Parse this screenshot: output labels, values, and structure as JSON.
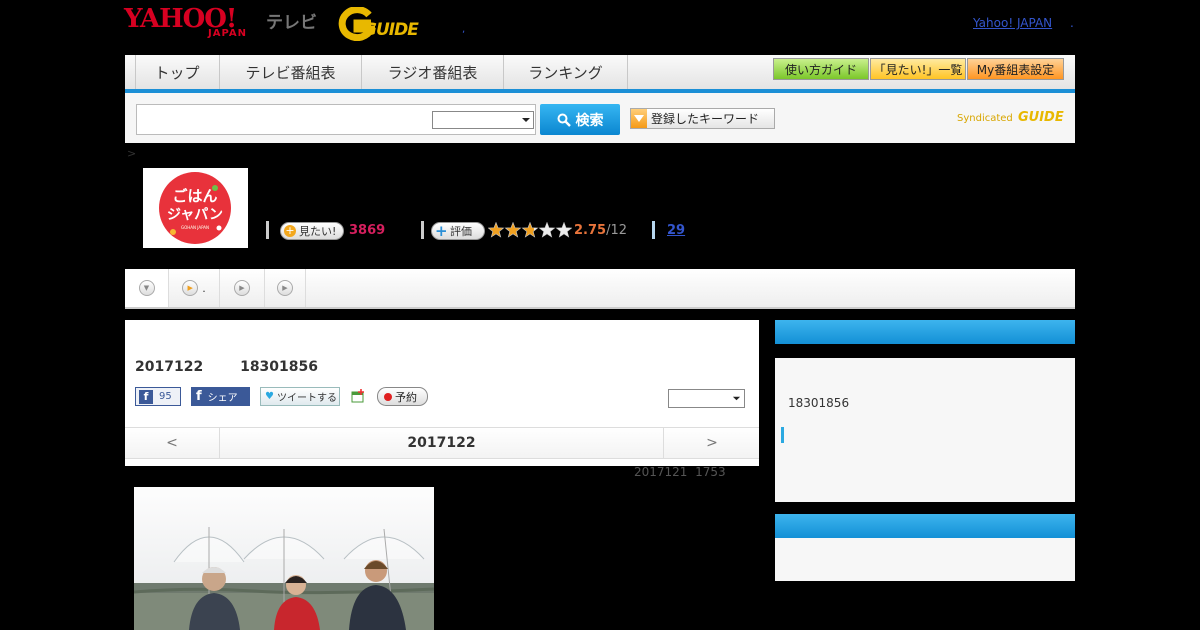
{
  "header": {
    "logo_text": "YAHOO!",
    "logo_sub": "JAPAN",
    "tv_label": "テレビ",
    "gguide_logo": "GUIDE",
    "yahoo_japan_link": "Yahoo! JAPAN",
    "link_dot": ".",
    "dot2": ","
  },
  "nav": {
    "tabs": [
      "トップ",
      "テレビ番組表",
      "ラジオ番組表",
      "ランキング"
    ],
    "buttons": [
      "使い方ガイド",
      "「見たい!」一覧",
      "My番組表設定"
    ],
    "button_colors": [
      "#8fd13f",
      "#ffd54a",
      "#ffa33b"
    ]
  },
  "search": {
    "placeholder": "",
    "button_label": "検索",
    "keyword_button_label": "登録したキーワード",
    "syndicated_label": "Syndicated",
    "syndicated_logo": "GUIDE"
  },
  "breadcrumb": {
    "sep": ">"
  },
  "program": {
    "image_title_line1": "ごはん",
    "image_title_line2": "ジャパン",
    "image_caption": "GOHAN JAPAN",
    "mitai_label": "見たい!",
    "mitai_count": "3869",
    "rating_label": "評価",
    "rating_value": "2.75",
    "rating_total": "/12",
    "rating_stars": 2.75,
    "comment_count": "29"
  },
  "tabs": {
    "tab2_suffix": "."
  },
  "episode": {
    "date": "2017122",
    "time": "18301856",
    "fb_count": "95",
    "fb_share": "シェア",
    "tweet": "ツイートする",
    "reserve": "予約",
    "pager_prev": "<",
    "pager_date": "2017122",
    "pager_next": ">",
    "updated": "2017121  1753"
  },
  "sidebar": {
    "time": "18301856"
  },
  "colors": {
    "accent": "#1b8fd6",
    "mitai_count": "#d61f5e",
    "rating": "#e8743b"
  }
}
